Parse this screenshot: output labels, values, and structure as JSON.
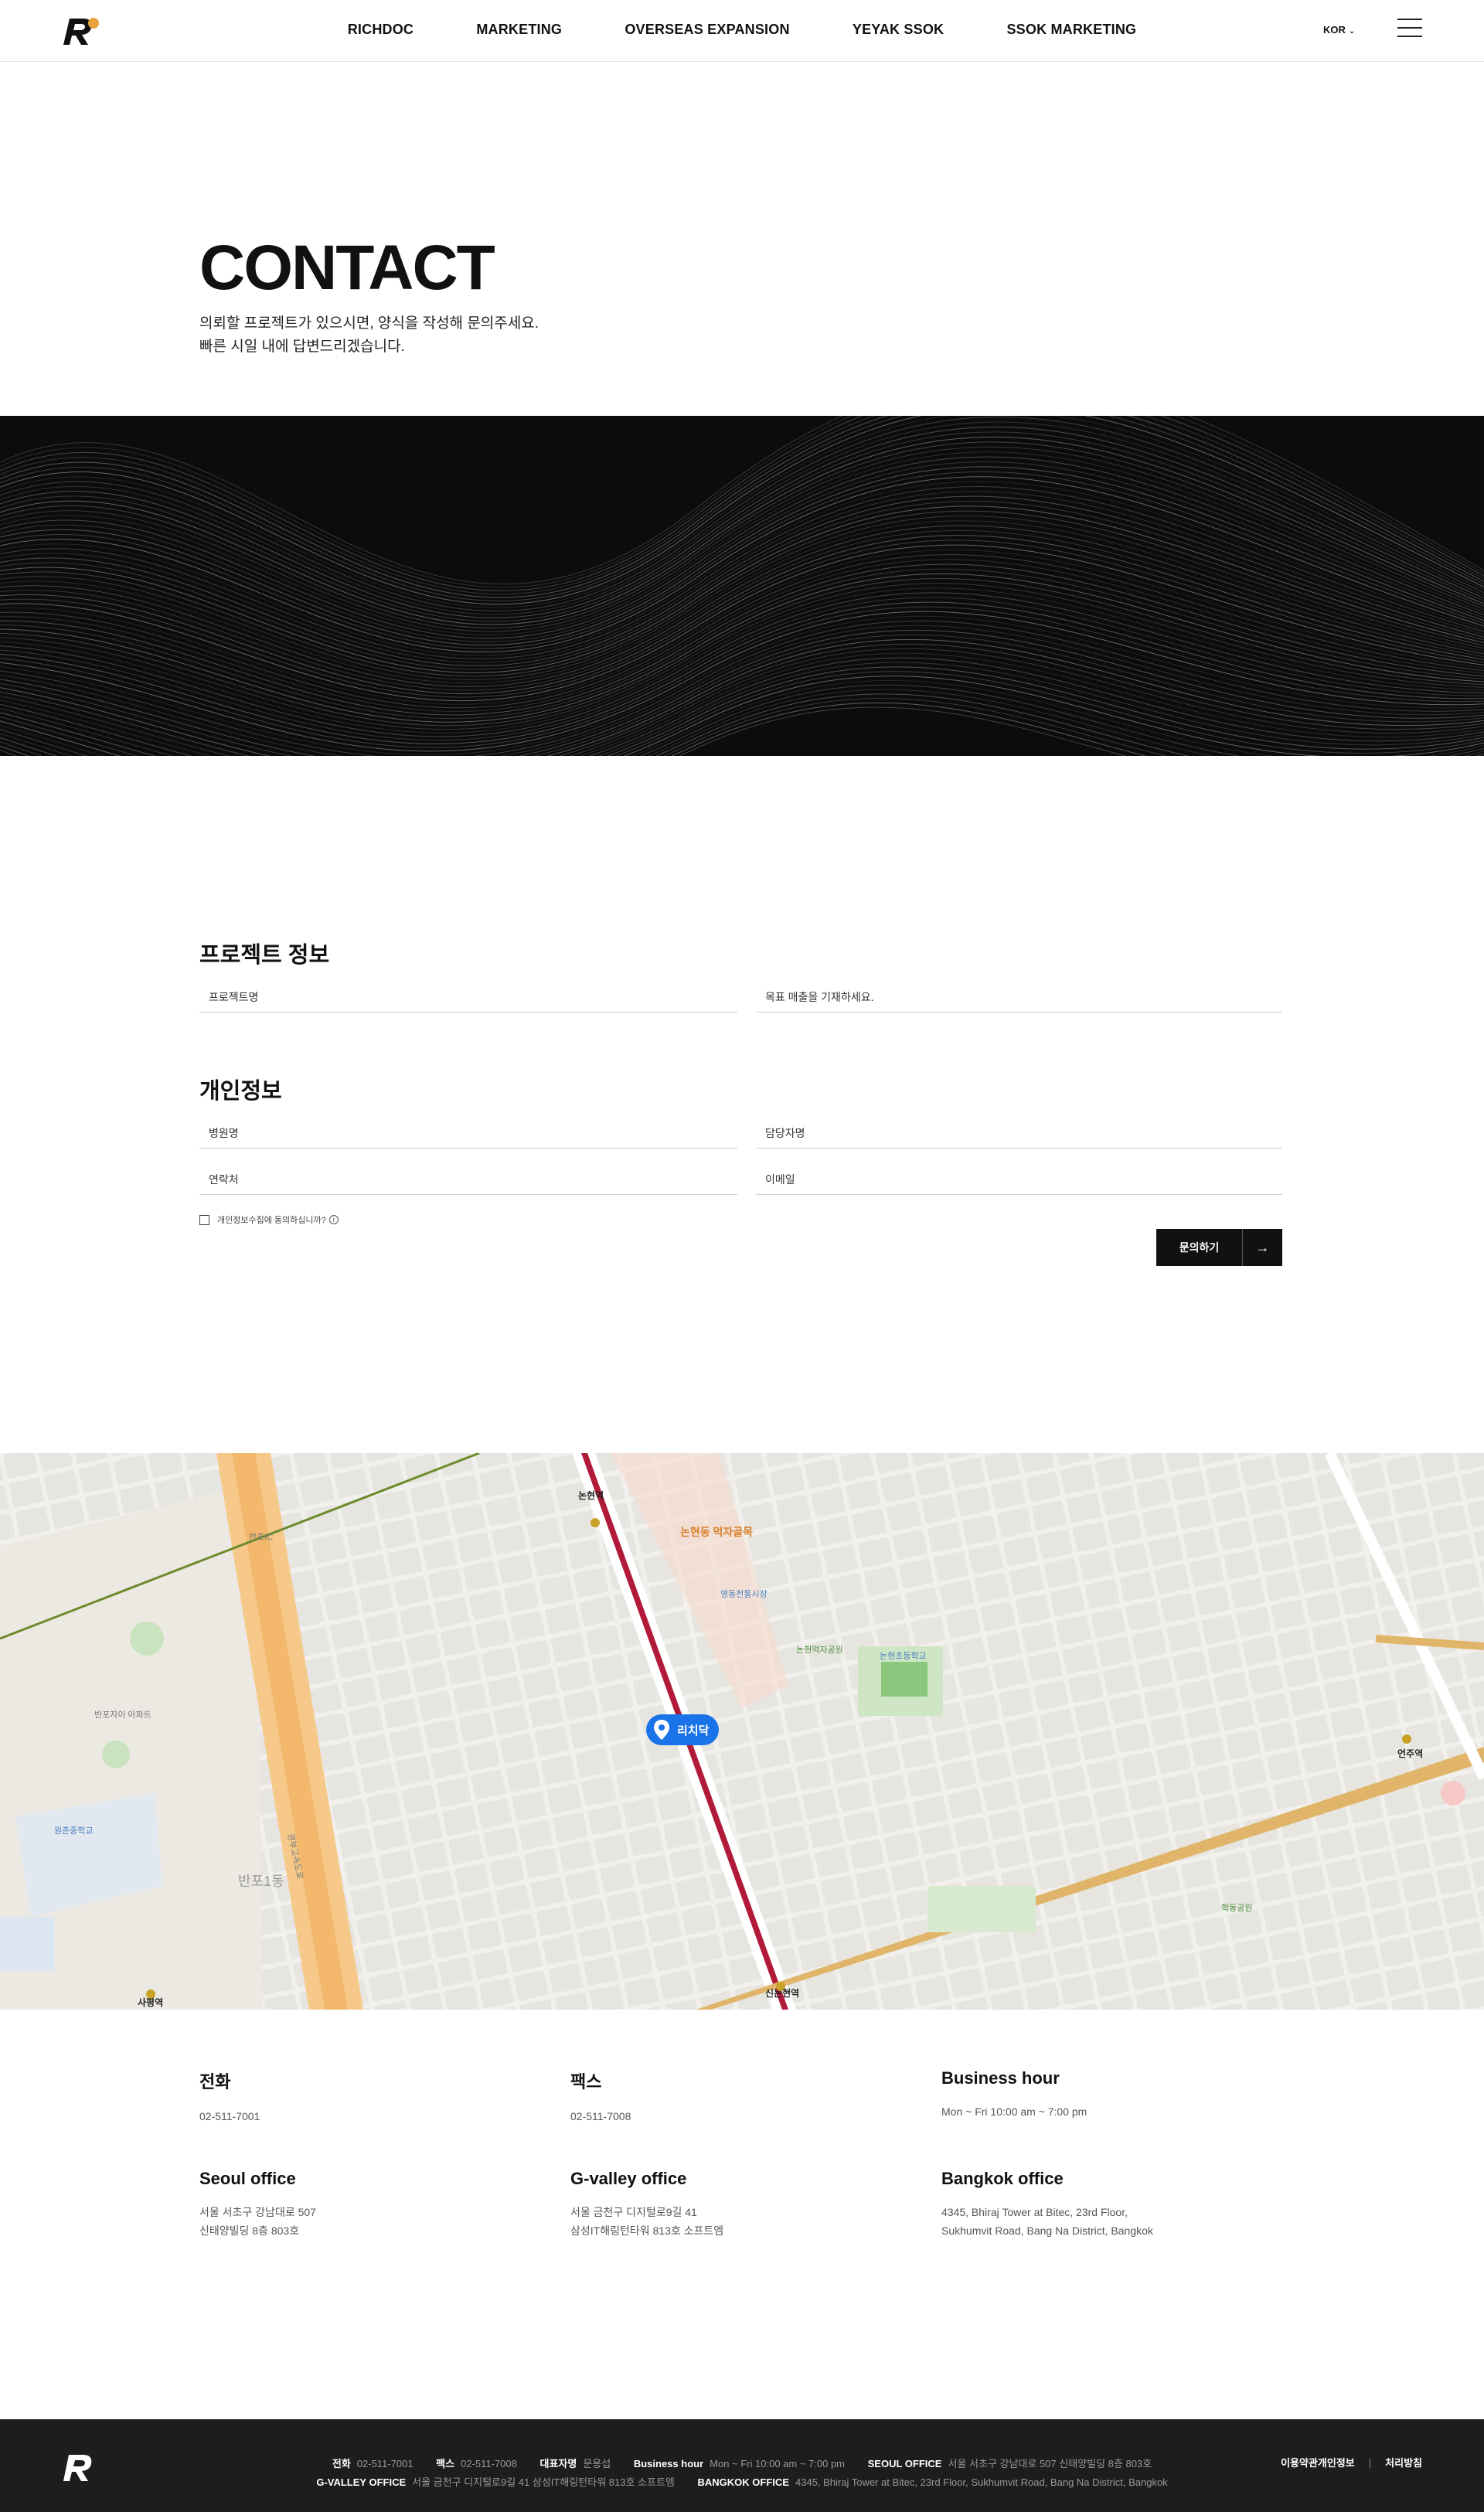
{
  "header": {
    "nav": [
      "RICHDOC",
      "MARKETING",
      "OVERSEAS EXPANSION",
      "YEYAK SSOK",
      "SSOK MARKETING"
    ],
    "lang": "KOR"
  },
  "hero": {
    "title": "CONTACT",
    "line1": "의뢰할 프로젝트가 있으시면, 양식을 작성해 문의주세요.",
    "line2": "빠른 시일 내에 답변드리겠습니다."
  },
  "form": {
    "project_title": "프로젝트 정보",
    "project_name": "프로젝트명",
    "target_sales": "목표 매출을 기재하세요.",
    "personal_title": "개인정보",
    "hospital": "병원명",
    "manager": "담당자명",
    "phone": "연락처",
    "email": "이메일",
    "consent": "개인정보수집에 동의하십니까?",
    "info_mark": "i",
    "submit": "문의하기"
  },
  "map": {
    "marker": "리치닥",
    "labels": {
      "nonhyeon_station": "논현역",
      "sinnonhyeon_station": "신논현역",
      "eonju_station": "언주역",
      "sapyeong_station": "사평역",
      "banpo1dong": "반포1동",
      "nonhyeon_food": "논현동 먹자골목",
      "nonhyeon_park": "논현먹자공원",
      "nonhyeon_elementary": "논현초등학교",
      "hakdong_park": "학동공원",
      "banpo_apartment": "반포자이 아파트",
      "wonchon_middle": "원촌중학교",
      "yeongdong_market": "영동전통시장",
      "banpo_ic": "반포IC",
      "gyeongbu": "경부고속도로"
    }
  },
  "contact": {
    "phone_title": "전화",
    "phone": "02-511-7001",
    "fax_title": "팩스",
    "fax": "02-511-7008",
    "hours_title": "Business hour",
    "hours": "Mon ~ Fri 10:00 am ~ 7:00 pm",
    "seoul_title": "Seoul office",
    "seoul_1": "서울 서초구 강남대로 507",
    "seoul_2": "신태양빌딩 8층 803호",
    "gvalley_title": "G-valley office",
    "gvalley_1": "서울 금천구 디지털로9길 41",
    "gvalley_2": "삼성IT해링턴타워 813호 소프트엠",
    "bangkok_title": "Bangkok office",
    "bangkok_1": "4345, Bhiraj Tower at Bitec, 23rd Floor,",
    "bangkok_2": "Sukhumvit Road, Bang Na District, Bangkok"
  },
  "footer": {
    "phone_label": "전화",
    "phone": "02-511-7001",
    "fax_label": "팩스",
    "fax": "02-511-7008",
    "ceo_label": "대표자명",
    "ceo": "문용섭",
    "hours_label": "Business hour",
    "hours": "Mon ~ Fri 10:00 am ~ 7:00 pm",
    "seoul_label": "SEOUL OFFICE",
    "seoul": "서울 서초구 강남대로 507 신태양빌딩 8층 803호",
    "gvalley_label": "G-VALLEY OFFICE",
    "gvalley": "서울 금천구 디지털로9길 41 삼성IT해링턴타워 813호 소프트엠",
    "bangkok_label": "BANGKOK OFFICE",
    "bangkok": "4345, Bhiraj Tower at Bitec, 23rd Floor, Sukhumvit Road, Bang Na District, Bangkok",
    "terms": "이용약관개인정보",
    "sep": "|",
    "policy": "처리방침"
  }
}
